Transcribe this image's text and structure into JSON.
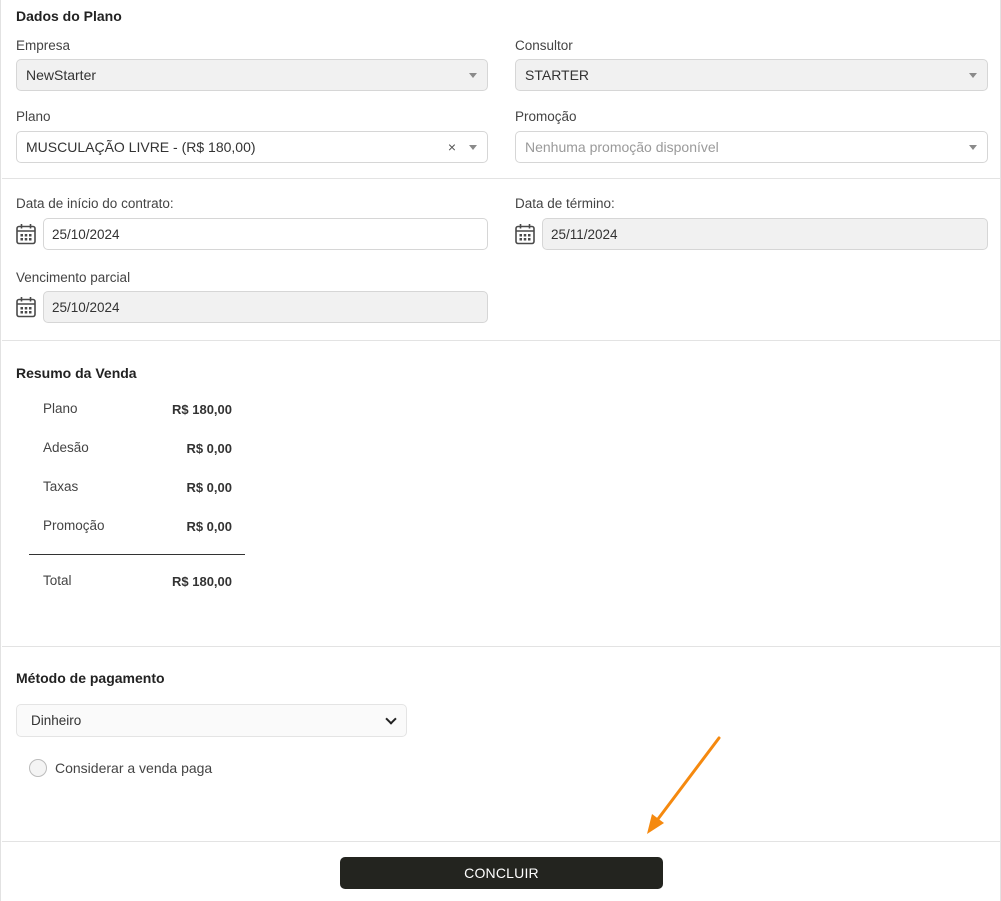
{
  "plan_section": {
    "title": "Dados do Plano",
    "empresa_label": "Empresa",
    "empresa_value": "NewStarter",
    "consultor_label": "Consultor",
    "consultor_value": "STARTER",
    "plano_label": "Plano",
    "plano_value": "MUSCULAÇÃO LIVRE - (R$ 180,00)",
    "plano_clear": "×",
    "promocao_label": "Promoção",
    "promocao_placeholder": "Nenhuma promoção disponível"
  },
  "dates_section": {
    "inicio_label": "Data de início do contrato:",
    "inicio_value": "25/10/2024",
    "termino_label": "Data de término:",
    "termino_value": "25/11/2024",
    "vencimento_label": "Vencimento parcial",
    "vencimento_value": "25/10/2024"
  },
  "summary": {
    "title": "Resumo da Venda",
    "rows": [
      {
        "label": "Plano",
        "value": "R$ 180,00"
      },
      {
        "label": "Adesão",
        "value": "R$ 0,00"
      },
      {
        "label": "Taxas",
        "value": "R$ 0,00"
      },
      {
        "label": "Promoção",
        "value": "R$ 0,00"
      }
    ],
    "total_label": "Total",
    "total_value": "R$ 180,00"
  },
  "payment": {
    "title": "Método de pagamento",
    "method_value": "Dinheiro",
    "paid_checkbox_label": "Considerar a venda paga",
    "paid_checked": false
  },
  "footer": {
    "submit_label": "CONCLUIR"
  },
  "annotation": {
    "arrow_color": "#f5890f"
  },
  "icons": [
    "calendar-icon",
    "chevron-down-icon",
    "dropdown-caret-icon",
    "clear-icon",
    "arrow-annotation"
  ]
}
